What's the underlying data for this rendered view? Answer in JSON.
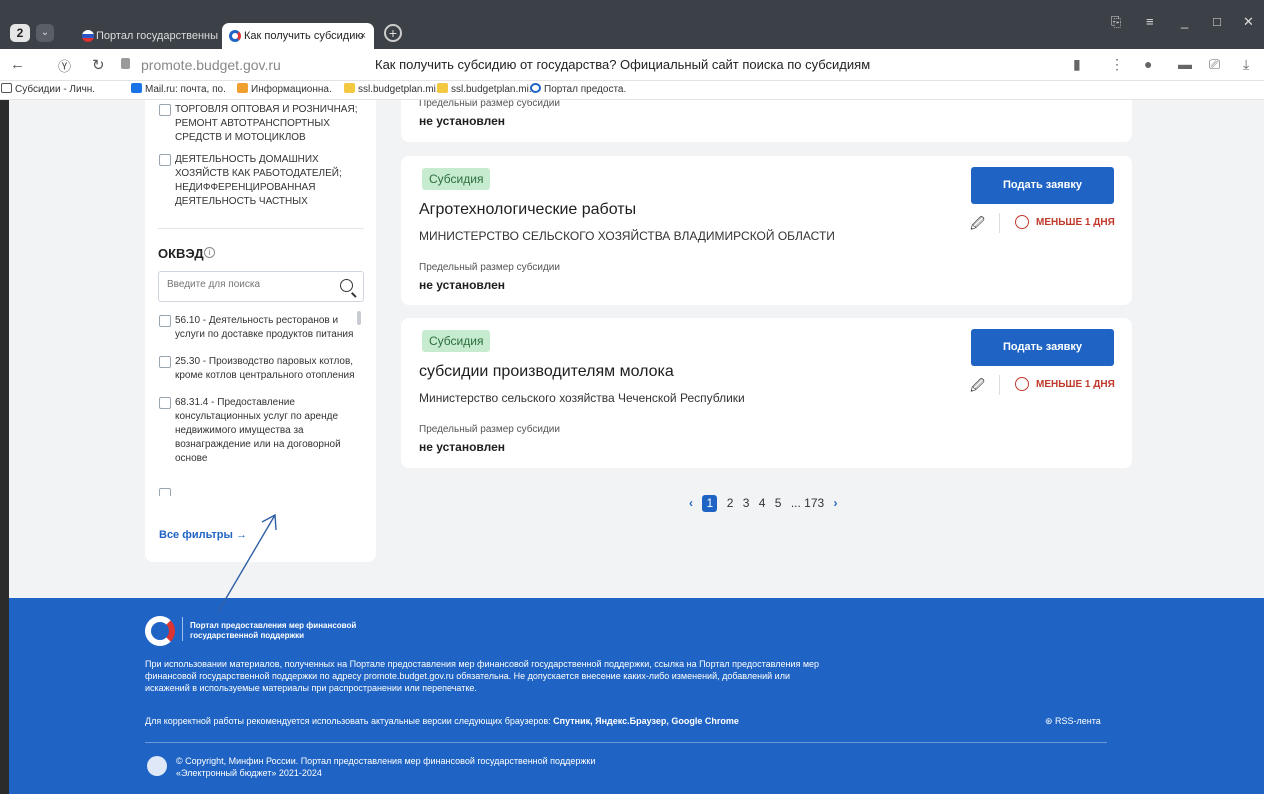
{
  "browser": {
    "tab_count": "2",
    "tabs": [
      {
        "title": "Портал государственных"
      },
      {
        "title": "Как получить субсидию"
      }
    ],
    "url": "promote.budget.gov.ru",
    "page_title": "Как получить субсидию от государства? Официальный сайт поиска по субсидиям",
    "bookmarks": [
      "Субсидии - Личн.",
      "Mail.ru: почта, по.",
      "Информационна.",
      "ssl.budgetplan.mi.",
      "ssl.budgetplan.mi.",
      "Портал предоста."
    ]
  },
  "sidebar": {
    "industry_items": [
      {
        "label": "ТОРГОВЛЯ ОПТОВАЯ И РОЗНИЧНАЯ; РЕМОНТ АВТОТРАНСПОРТНЫХ СРЕДСТВ И МОТОЦИКЛОВ"
      },
      {
        "label": "ДЕЯТЕЛЬНОСТЬ ДОМАШНИХ ХОЗЯЙСТВ КАК РАБОТОДАТЕЛЕЙ; НЕДИФФЕРЕНЦИРОВАННАЯ ДЕЯТЕЛЬНОСТЬ ЧАСТНЫХ"
      }
    ],
    "okved_title": "ОКВЭД",
    "search_placeholder": "Введите для поиска",
    "okved_items": [
      {
        "label": "56.10 - Деятельность ресторанов и услуги по доставке продуктов питания"
      },
      {
        "label": "25.30 - Производство паровых котлов, кроме котлов центрального отопления"
      },
      {
        "label": "68.31.4 - Предоставление консультационных услуг по аренде недвижимого имущества за вознаграждение или на договорной основе"
      }
    ],
    "all_filters": "Все фильтры →"
  },
  "cards": [
    {
      "limit_label": "Предельный размер субсидии",
      "limit_value": "не установлен"
    },
    {
      "badge": "Субсидия",
      "title": "Агротехнологические работы",
      "org": "МИНИСТЕРСТВО СЕЛЬСКОГО ХОЗЯЙСТВА ВЛАДИМИРСКОЙ ОБЛАСТИ",
      "limit_label": "Предельный размер субсидии",
      "limit_value": "не установлен",
      "button": "Подать заявку",
      "deadline": "МЕНЬШЕ 1 ДНЯ"
    },
    {
      "badge": "Субсидия",
      "title": "субсидии производителям молока",
      "org": "Министерство сельского хозяйства Чеченской Республики",
      "limit_label": "Предельный размер субсидии",
      "limit_value": "не установлен",
      "button": "Подать заявку",
      "deadline": "МЕНЬШЕ 1 ДНЯ"
    }
  ],
  "pagination": {
    "current": "1",
    "pages": [
      "2",
      "3",
      "4",
      "5"
    ],
    "last": "... 173"
  },
  "footer": {
    "org_name": "Портал предоставления мер финансовой государственной поддержки",
    "paragraph": "При использовании материалов, полученных на Портале предоставления мер финансовой государственной поддержки, ссылка на Портал предоставления мер финансовой государственной поддержки по адресу promote.budget.gov.ru обязательна. Не допускается внесение каких-либо изменений, добавлений или искажений в используемые материалы при распространении или перепечатке.",
    "browsers_text": "Для корректной работы рекомендуется использовать актуальные версии следующих браузеров:",
    "browsers": "Спутник, Яндекс.Браузер, Google Chrome",
    "rss": "RSS-лента",
    "copyright_line1": "© Copyright, Минфин России. Портал предоставления мер финансовой государственной поддержки",
    "copyright_line2": "«Электронный бюджет» 2021-2024"
  }
}
